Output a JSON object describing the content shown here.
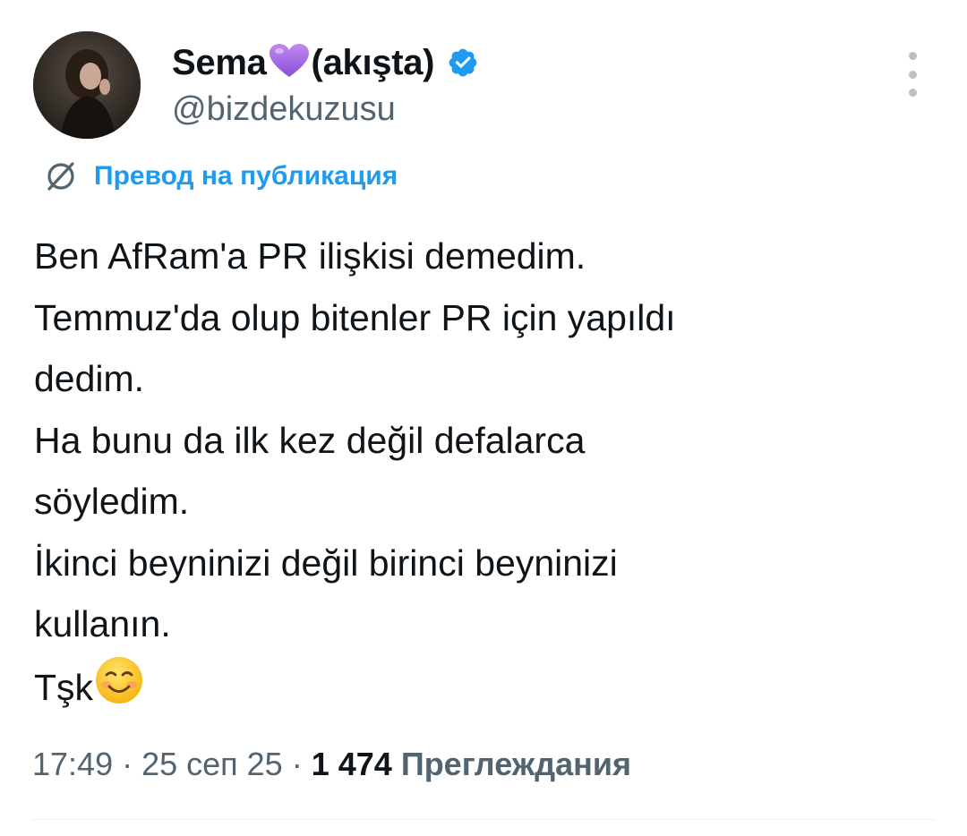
{
  "author": {
    "display_name_prefix": "Sema",
    "display_name_suffix": "(akışta)",
    "heart_icon": "purple-heart-emoji",
    "verified_icon": "verified-badge-icon",
    "handle": "@bizdekuzusu",
    "avatar_icon": "profile-photo"
  },
  "translate": {
    "icon": "translate-globe-icon",
    "label": "Превод на публикация"
  },
  "tweet": {
    "lines": [
      "Ben AfRam'a PR ilişkisi demedim.",
      "Temmuz'da olup bitenler PR için yapıldı",
      "dedim.",
      "Ha bunu da ilk kez değil defalarca",
      "söyledim.",
      "İkinci beyninizi değil birinci beyninizi",
      "kullanın.",
      "Tşk"
    ],
    "emoji_icon": "smiling-face-emoji"
  },
  "meta": {
    "time": "17:49",
    "separator": " · ",
    "date": "25 сеп 25",
    "views_count": "1 474",
    "views_label": "Преглеждания"
  },
  "colors": {
    "accent": "#1d9bf0",
    "text": "#0f1419",
    "secondary": "#536471",
    "heart": "#a56de0"
  }
}
